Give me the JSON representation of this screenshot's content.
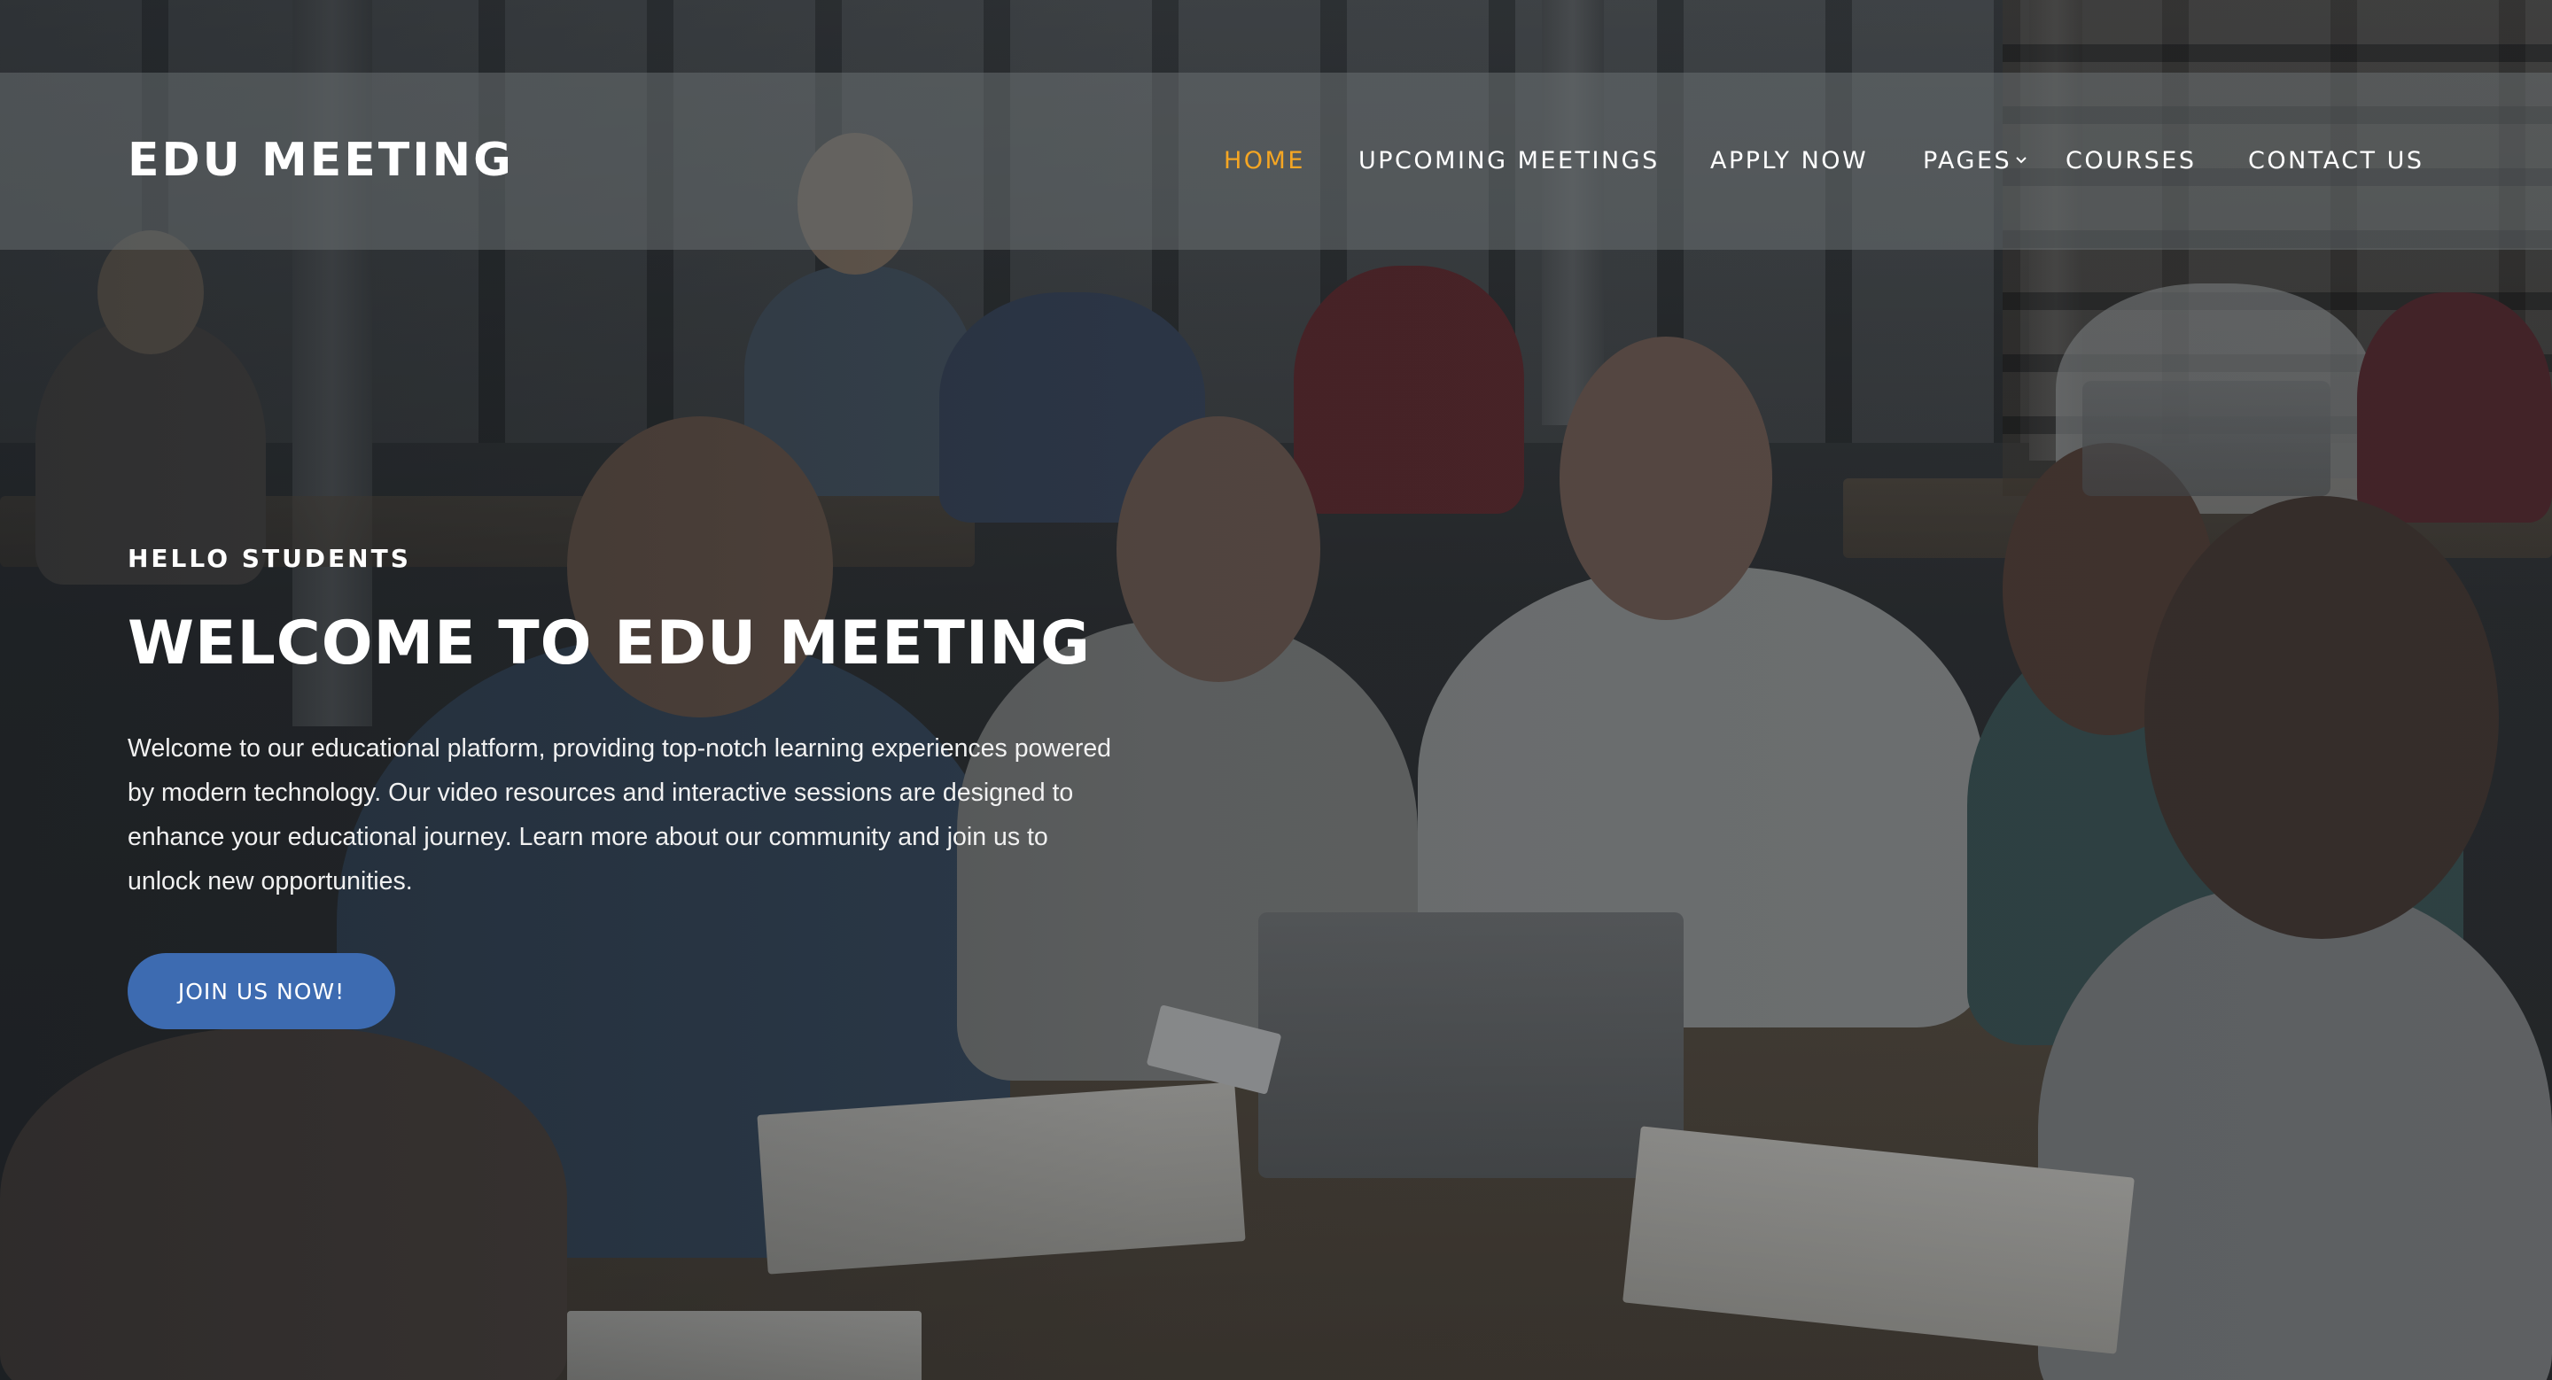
{
  "header": {
    "logo": "EDU MEETING",
    "nav": [
      {
        "label": "HOME",
        "active": true
      },
      {
        "label": "UPCOMING MEETINGS",
        "active": false
      },
      {
        "label": "APPLY NOW",
        "active": false
      },
      {
        "label": "PAGES",
        "active": false,
        "has_dropdown": true
      },
      {
        "label": "COURSES",
        "active": false
      },
      {
        "label": "CONTACT US",
        "active": false
      }
    ],
    "active_color": "#f5a623",
    "dropdown_icon": "chevron-down-icon"
  },
  "hero": {
    "kicker": "HELLO STUDENTS",
    "title": "WELCOME TO EDU MEETING",
    "description": "Welcome to our educational platform, providing top-notch learning experiences powered by modern technology. Our video resources and interactive sessions are designed to enhance your educational journey. Learn more about our community and join us to unlock new opportunities.",
    "button_label": "JOIN US NOW!",
    "button_color": "#3d6bb1"
  }
}
